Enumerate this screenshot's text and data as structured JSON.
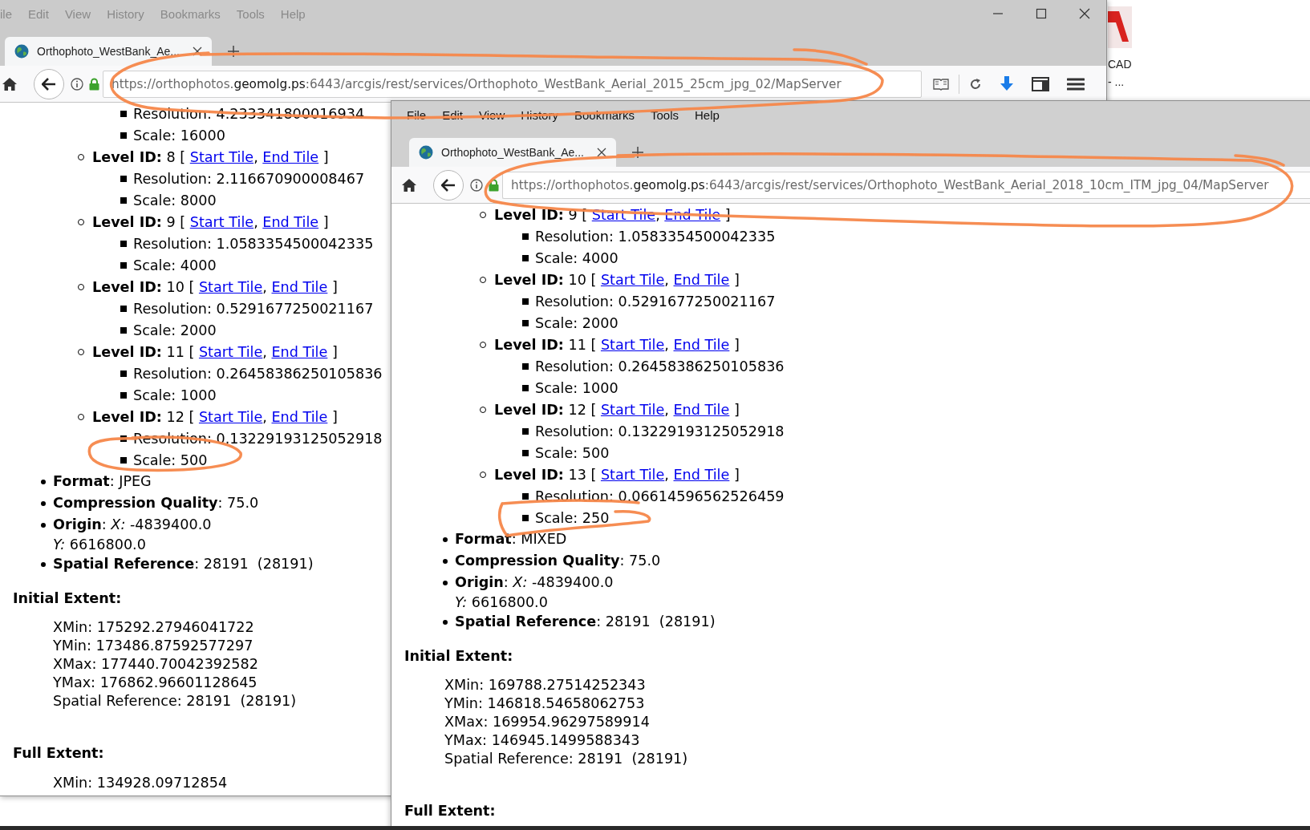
{
  "windows": [
    {
      "active": false,
      "window_controls": true,
      "menu": [
        "ile",
        "Edit",
        "View",
        "History",
        "Bookmarks",
        "Tools",
        "Help"
      ],
      "tab": {
        "title": "Orthophoto_WestBank_Ae...",
        "selected": true
      },
      "url": {
        "pre": "https://orthophotos.",
        "host": "geomolg.ps",
        "post": ":6443/arcgis/rest/services/Orthophoto_WestBank_Aerial_2015_25cm_jpg_02/MapServer"
      },
      "levels": [
        {
          "items": [
            "Resolution: 4.233341800016934",
            "Scale: 16000"
          ]
        },
        {
          "heading": "**Level ID:** 8 [",
          "links": [
            "Start Tile",
            "End Tile"
          ],
          "separator": ",",
          "close": "]",
          "items": [
            "Resolution: 2.116670900008467",
            "Scale: 8000"
          ]
        },
        {
          "heading": "**Level ID:** 9 [",
          "links": [
            "Start Tile",
            "End Tile"
          ],
          "separator": ",",
          "close": "]",
          "items": [
            "Resolution: 1.0583354500042335",
            "Scale: 4000"
          ]
        },
        {
          "heading": "**Level ID:** 10 [",
          "links": [
            "Start Tile",
            "End Tile"
          ],
          "separator": ",",
          "close": "]",
          "items": [
            "Resolution: 0.5291677250021167",
            "Scale: 2000"
          ]
        },
        {
          "heading": "**Level ID:** 11 [",
          "links": [
            "Start Tile",
            "End Tile"
          ],
          "separator": ",",
          "close": "]",
          "items": [
            "Resolution: 0.26458386250105836",
            "Scale: 1000"
          ]
        },
        {
          "heading": "**Level ID:** 12 [",
          "links": [
            "Start Tile",
            "End Tile"
          ],
          "separator": ",",
          "close": "]",
          "items": [
            "Resolution: 0.13229193125052918",
            "Scale: 500"
          ]
        }
      ],
      "properties": [
        {
          "lines": [
            "**Format**: JPEG"
          ]
        },
        {
          "lines": [
            "**Compression Quality**: 75.0"
          ]
        },
        {
          "lines": [
            "**Origin**: *X:* -4839400.0",
            "*Y:* 6616800.0"
          ]
        },
        {
          "lines": [
            "**Spatial Reference**: 28191  (28191)"
          ]
        }
      ],
      "extents": [
        {
          "title": "Initial Extent:",
          "lines": [
            "XMin: 175292.27946041722",
            "YMin: 173486.87592577297",
            "XMax: 177440.70042392582",
            "YMax: 176862.96601128645",
            "Spatial Reference: 28191  (28191)"
          ]
        },
        {
          "title": "Full Extent:",
          "lines": [
            "XMin: 134928.09712854"
          ]
        }
      ]
    },
    {
      "active": true,
      "menu": [
        "File",
        "Edit",
        "View",
        "History",
        "Bookmarks",
        "Tools",
        "Help"
      ],
      "tab": {
        "title": "Orthophoto_WestBank_Ae...",
        "selected": true
      },
      "url": {
        "pre": "https://orthophotos.",
        "host": "geomolg.ps",
        "post": ":6443/arcgis/rest/services/Orthophoto_WestBank_Aerial_2018_10cm_ITM_jpg_04/MapServer"
      },
      "levels": [
        {
          "heading": "**Level ID:** 9 [",
          "links": [
            "Start Tile",
            "End Tile"
          ],
          "separator": ",",
          "close": "]",
          "items": [
            "Resolution: 1.0583354500042335",
            "Scale: 4000"
          ]
        },
        {
          "heading": "**Level ID:** 10 [",
          "links": [
            "Start Tile",
            "End Tile"
          ],
          "separator": ",",
          "close": "]",
          "items": [
            "Resolution: 0.5291677250021167",
            "Scale: 2000"
          ]
        },
        {
          "heading": "**Level ID:** 11 [",
          "links": [
            "Start Tile",
            "End Tile"
          ],
          "separator": ",",
          "close": "]",
          "items": [
            "Resolution: 0.26458386250105836",
            "Scale: 1000"
          ]
        },
        {
          "heading": "**Level ID:** 12 [",
          "links": [
            "Start Tile",
            "End Tile"
          ],
          "separator": ",",
          "close": "]",
          "items": [
            "Resolution: 0.13229193125052918",
            "Scale: 500"
          ]
        },
        {
          "heading": "**Level ID:** 13 [",
          "links": [
            "Start Tile",
            "End Tile"
          ],
          "separator": ",",
          "close": "]",
          "items": [
            "Resolution: 0.06614596562526459",
            "Scale: 250"
          ]
        }
      ],
      "properties": [
        {
          "lines": [
            "**Format**: MIXED"
          ]
        },
        {
          "lines": [
            "**Compression Quality**: 75.0"
          ]
        },
        {
          "lines": [
            "**Origin**: *X:* -4839400.0",
            "*Y:* 6616800.0"
          ]
        },
        {
          "lines": [
            "**Spatial Reference**: 28191  (28191)"
          ]
        }
      ],
      "extents": [
        {
          "title": "Initial Extent:",
          "lines": [
            "XMin: 169788.27514252343",
            "YMin: 146818.54658062753",
            "XMax: 169954.96297589914",
            "YMax: 146945.1499588343",
            "Spatial Reference: 28191  (28191)"
          ]
        },
        {
          "title": "Full Extent:"
        }
      ]
    }
  ],
  "desktop": {
    "labels": [
      "CAD",
      "- ..."
    ]
  }
}
